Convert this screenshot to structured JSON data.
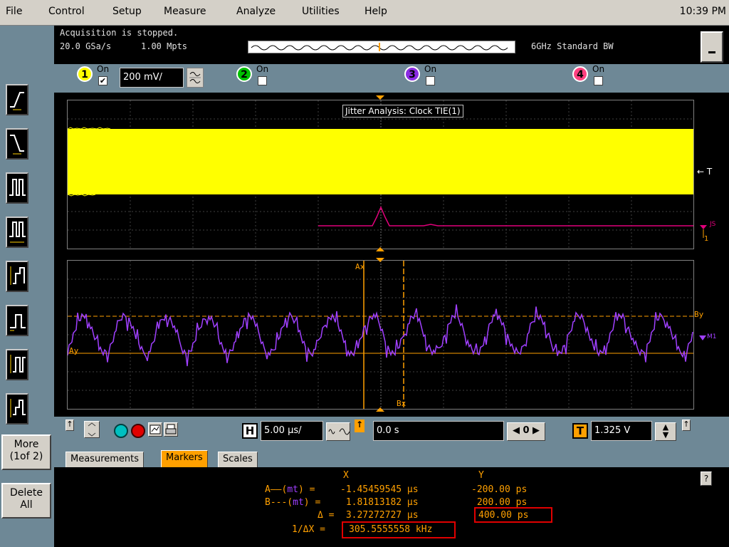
{
  "menu": {
    "items": [
      "File",
      "Control",
      "Setup",
      "Measure",
      "Analyze",
      "Utilities",
      "Help"
    ],
    "clock": "10:39 PM"
  },
  "status": {
    "acquisition": "Acquisition is stopped.",
    "sample_rate": "20.0 GSa/s",
    "memory": "1.00 Mpts",
    "bandwidth": "6GHz Standard BW"
  },
  "channels": [
    {
      "num": "1",
      "on_label": "On",
      "checked": true,
      "color": "#ffff00",
      "scale": "200 mV/"
    },
    {
      "num": "2",
      "on_label": "On",
      "checked": false,
      "color": "#00c000"
    },
    {
      "num": "3",
      "on_label": "On",
      "checked": false,
      "color": "#8a2be2"
    },
    {
      "num": "4",
      "on_label": "On",
      "checked": false,
      "color": "#ff4080"
    }
  ],
  "waveform": {
    "upper_label": "Jitter Analysis: Clock TIE(1)",
    "trigger_marker": "← T",
    "js_marker": "JS",
    "js_marker2": "1",
    "ax_label": "Ax",
    "bx_label": "Bx",
    "ay_label": "Ay",
    "by_label": "By",
    "m1_marker": "M1"
  },
  "left_panel": {
    "more_label_1": "More",
    "more_label_2": "(1of 2)",
    "delete_label_1": "Delete",
    "delete_label_2": "All"
  },
  "controls": {
    "h_label": "H",
    "timebase": "5.00 µs/",
    "delay": "0.0 s",
    "zero_label": "0",
    "t_label": "T",
    "trigger_level": "1.325 V"
  },
  "tabs": [
    "Measurements",
    "Markers",
    "Scales"
  ],
  "active_tab": "Markers",
  "results": {
    "x_header": "X",
    "y_header": "Y",
    "rows": [
      {
        "label": "A——(",
        "mt": "mt",
        "suffix": ") =",
        "x": "-1.45459545 µs",
        "y": "-200.00 ps"
      },
      {
        "label": "B---(",
        "mt": "mt",
        "suffix": ") =",
        "x": " 1.81813182 µs",
        "y": " 200.00 ps"
      }
    ],
    "delta_label": "Δ =",
    "delta_x": " 3.27272727 µs",
    "delta_y": "400.00 ps",
    "inv_label": "1/ΔX =",
    "inv_x": "305.5555558 kHz",
    "help": "?"
  },
  "colors": {
    "panel": "#6e8896",
    "marker_orange": "#ffa000",
    "ch1_yellow": "#ffff00",
    "math_purple": "#a040ff",
    "js_pink": "#e0007a"
  }
}
